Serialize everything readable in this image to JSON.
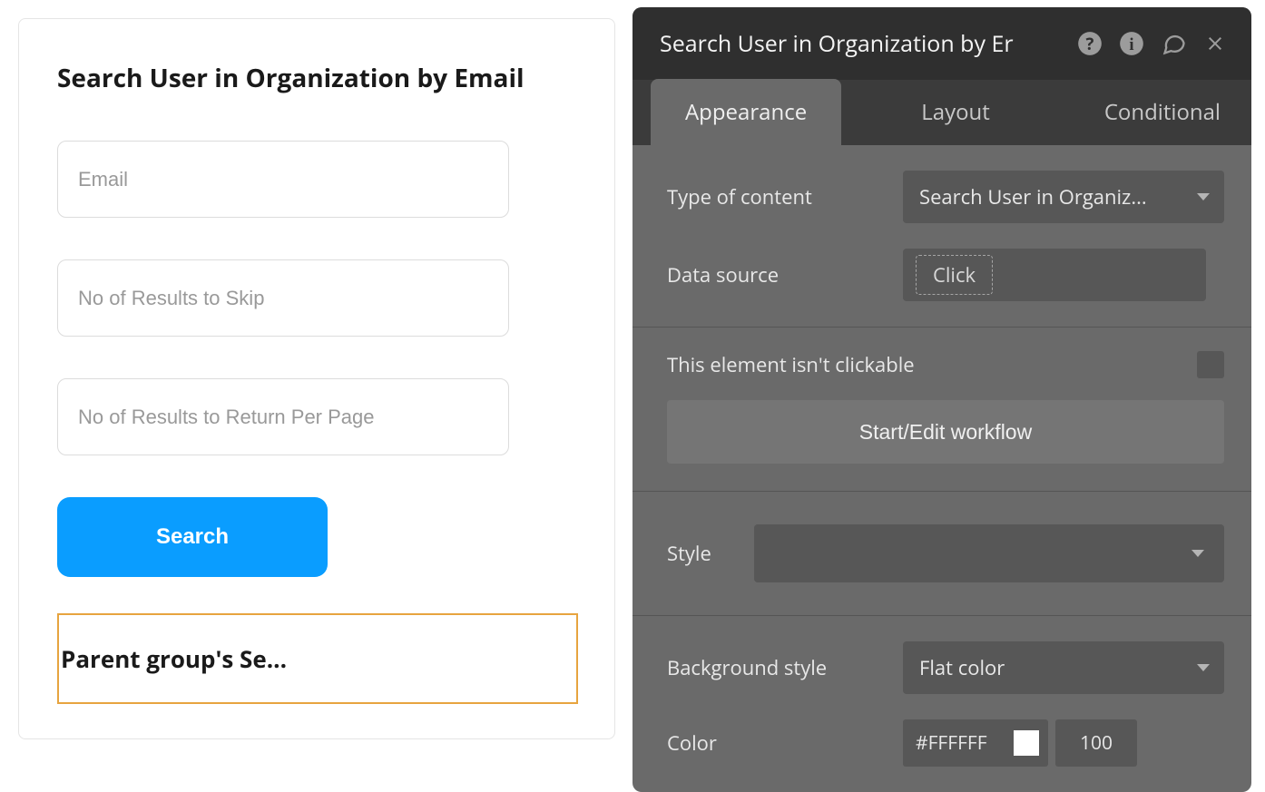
{
  "canvas": {
    "title": "Search User in Organization by Email",
    "inputs": {
      "email_placeholder": "Email",
      "skip_placeholder": "No of Results to Skip",
      "per_page_placeholder": "No of Results to Return Per Page"
    },
    "search_button_label": "Search",
    "selected_element_text": "Parent group's Se..."
  },
  "editor": {
    "header_title": "Search User in Organization by Er",
    "tabs": {
      "appearance": "Appearance",
      "layout": "Layout",
      "conditional": "Conditional"
    },
    "properties": {
      "type_of_content_label": "Type of content",
      "type_of_content_value": "Search User in Organiz...",
      "data_source_label": "Data source",
      "data_source_value": "Click",
      "not_clickable_text": "This element isn't clickable",
      "workflow_button": "Start/Edit workflow",
      "style_label": "Style",
      "background_style_label": "Background style",
      "background_style_value": "Flat color",
      "color_label": "Color",
      "color_value": "#FFFFFF",
      "color_alpha": "100"
    }
  }
}
